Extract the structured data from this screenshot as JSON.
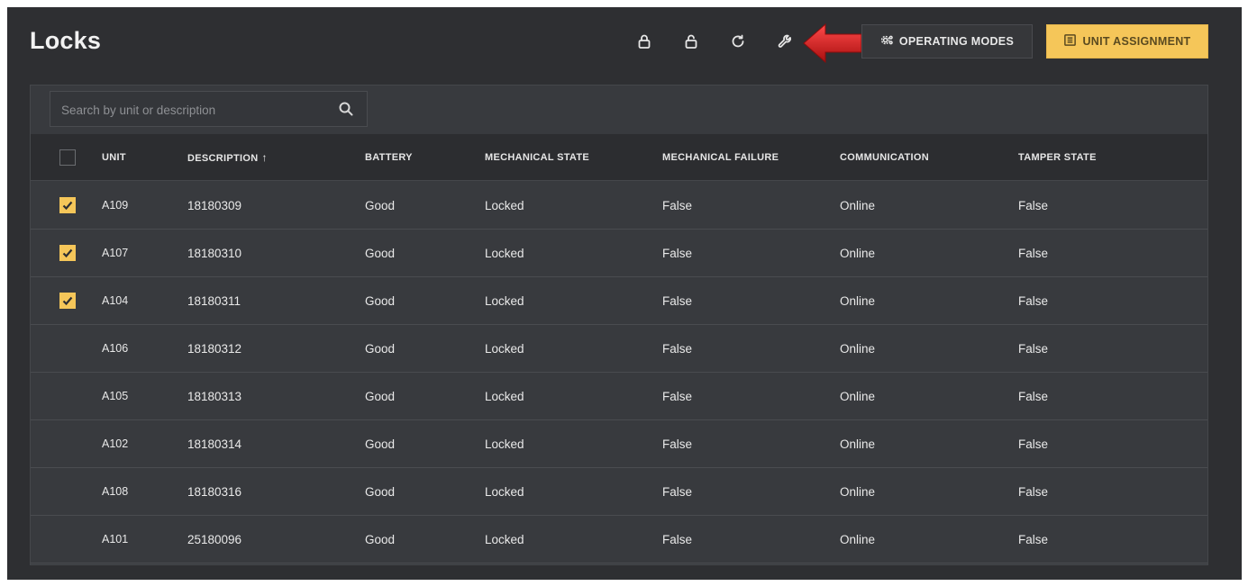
{
  "header": {
    "title": "Locks",
    "operating_modes_label": "OPERATING MODES",
    "unit_assignment_label": "UNIT ASSIGNMENT"
  },
  "toolbar_icons": [
    "lock-icon",
    "unlock-icon",
    "refresh-icon",
    "wrench-icon"
  ],
  "search": {
    "placeholder": "Search by unit or description",
    "value": ""
  },
  "table": {
    "columns": {
      "unit": "UNIT",
      "description": "DESCRIPTION",
      "battery": "BATTERY",
      "mechanical_state": "MECHANICAL STATE",
      "mechanical_failure": "MECHANICAL FAILURE",
      "communication": "COMMUNICATION",
      "tamper_state": "TAMPER STATE"
    },
    "sort": {
      "column": "description",
      "direction": "ascending"
    },
    "rows": [
      {
        "checked": true,
        "unit": "A109",
        "description": "18180309",
        "battery": "Good",
        "mechanical_state": "Locked",
        "mechanical_failure": "False",
        "communication": "Online",
        "tamper_state": "False"
      },
      {
        "checked": true,
        "unit": "A107",
        "description": "18180310",
        "battery": "Good",
        "mechanical_state": "Locked",
        "mechanical_failure": "False",
        "communication": "Online",
        "tamper_state": "False"
      },
      {
        "checked": true,
        "unit": "A104",
        "description": "18180311",
        "battery": "Good",
        "mechanical_state": "Locked",
        "mechanical_failure": "False",
        "communication": "Online",
        "tamper_state": "False"
      },
      {
        "checked": false,
        "unit": "A106",
        "description": "18180312",
        "battery": "Good",
        "mechanical_state": "Locked",
        "mechanical_failure": "False",
        "communication": "Online",
        "tamper_state": "False"
      },
      {
        "checked": false,
        "unit": "A105",
        "description": "18180313",
        "battery": "Good",
        "mechanical_state": "Locked",
        "mechanical_failure": "False",
        "communication": "Online",
        "tamper_state": "False"
      },
      {
        "checked": false,
        "unit": "A102",
        "description": "18180314",
        "battery": "Good",
        "mechanical_state": "Locked",
        "mechanical_failure": "False",
        "communication": "Online",
        "tamper_state": "False"
      },
      {
        "checked": false,
        "unit": "A108",
        "description": "18180316",
        "battery": "Good",
        "mechanical_state": "Locked",
        "mechanical_failure": "False",
        "communication": "Online",
        "tamper_state": "False"
      },
      {
        "checked": false,
        "unit": "A101",
        "description": "25180096",
        "battery": "Good",
        "mechanical_state": "Locked",
        "mechanical_failure": "False",
        "communication": "Online",
        "tamper_state": "False"
      }
    ]
  },
  "colors": {
    "background": "#2e2f32",
    "panel": "#383a3e",
    "accent": "#f5c659",
    "annotation_arrow": "#d11f1f"
  }
}
